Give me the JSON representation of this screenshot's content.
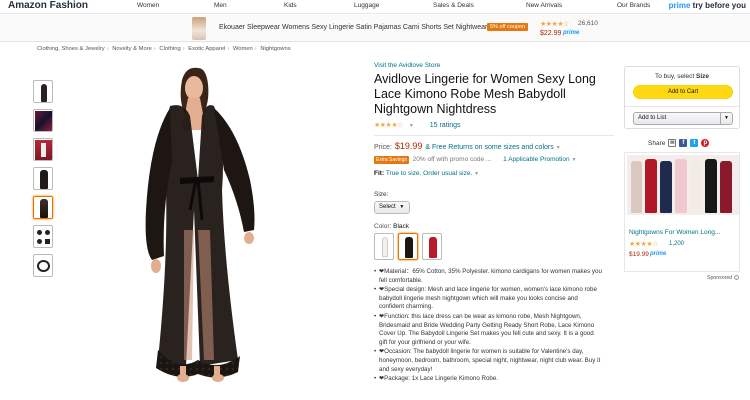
{
  "topnav": {
    "brand": "Amazon Fashion",
    "items": [
      "Women",
      "Men",
      "Kids",
      "Luggage",
      "Sales & Deals",
      "New Arrivals",
      "Our Brands"
    ],
    "prime_prefix": "prime",
    "prime_suffix": "try before you"
  },
  "banner": {
    "title": "Ekouaer Sleepwear Womens Sexy Lingerie Satin Pajamas Cami Shorts Set Nightwear",
    "coupon": "5% off coupon",
    "stars": "★★★★☆",
    "rating_count": "26,610",
    "price": "$22.99",
    "prime": "prime"
  },
  "breadcrumb": [
    "Clothing, Shoes & Jewelry",
    "Novelty & More",
    "Clothing",
    "Exotic Apparel",
    "Women",
    "Nightgowns"
  ],
  "product": {
    "store": "Visit the Avidlove Store",
    "title": "Avidlove Lingerie for Women Sexy Long Lace Kimono Robe Mesh Babydoll Nightgown Nightdress",
    "stars": "★★★★☆",
    "rating_count": "15 ratings",
    "price_label": "Price:",
    "price": "$19.99",
    "returns": "& Free Returns on some sizes and colors",
    "promo_badge": "Extra Savings",
    "promo_text": "20% off with promo code ...",
    "promo_link": "1 Applicable Promotion",
    "fit_label": "Fit:",
    "fit_text": "True to size. Order usual size.",
    "size_label": "Size:",
    "size_select": "Select",
    "color_label": "Color:",
    "color_value": "Black",
    "bullets": [
      "❤Material：65% Cotton, 35% Polyester. kimono cardigans for women makes you fell comfortable.",
      "❤Special design: Mesh and lace lingerie for women, women's lace kimono robe babydoll lingerie mesh nightgown which will make you looks concise and confident charming.",
      "❤Function: this lace dress can be wear as kimono robe, Mesh Nightgown, Bridesmaid and Bride Wedding Party Getting Ready Short Robe, Lace Kimono Cover Up. The Babydoll Lingerie Set makes you fell cute and sexy. It is a good gift for your girlfriend or your wife.",
      "❤Occasion: The babydoll lingerie for women is suitable for Valentine's day, honeymoon, bedroom, bathroom, special night, nightwear, night club wear. Buy it and sexy everyday!",
      "❤Package: 1x Lace Lingerie Kimono Robe."
    ]
  },
  "buybox": {
    "to_buy_prefix": "To buy, select",
    "to_buy_bold": "Size",
    "add_to_cart": "Add to Cart",
    "add_to_list": "Add to List"
  },
  "share": {
    "label": "Share"
  },
  "ad": {
    "title": "Nightgowns For Women Long...",
    "stars": "★★★★☆",
    "rating_count": "1,200",
    "price": "$19.99",
    "prime": "prime",
    "sponsored": "Sponsored"
  }
}
